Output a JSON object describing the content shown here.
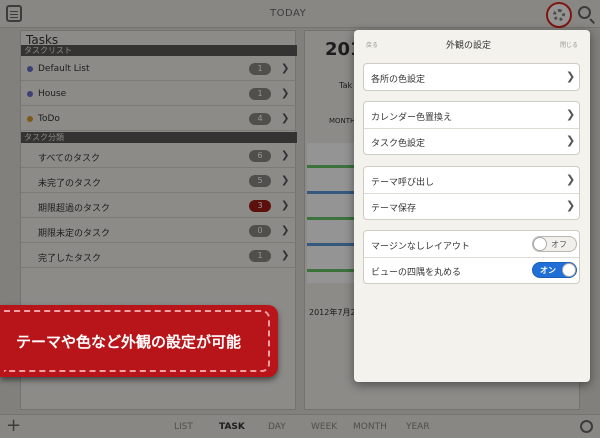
{
  "topbar": {
    "today_label": "TODAY"
  },
  "tasks": {
    "title": "Tasks",
    "list_section": "タスクリスト",
    "lists": [
      {
        "label": "Default List",
        "count": "1",
        "color": "#6a6ecf"
      },
      {
        "label": "House",
        "count": "1",
        "color": "#6a6ecf"
      },
      {
        "label": "ToDo",
        "count": "4",
        "color": "#d89a2a"
      }
    ],
    "category_section": "タスク分類",
    "categories": [
      {
        "label": "すべてのタスク",
        "count": "6"
      },
      {
        "label": "未完了のタスク",
        "count": "5"
      },
      {
        "label": "期限超過のタスク",
        "count": "3"
      },
      {
        "label": "期限未定のタスク",
        "count": "0"
      },
      {
        "label": "完了したタスク",
        "count": "1"
      }
    ]
  },
  "calendar_bg": {
    "year": "201",
    "tak": "Tak",
    "month_tab": "MONTH",
    "jul": "2012年7月2"
  },
  "bottom": {
    "tabs": [
      "LIST",
      "TASK",
      "DAY",
      "WEEK",
      "MONTH",
      "YEAR"
    ],
    "active": "TASK"
  },
  "popover": {
    "back_label": "戻る",
    "title": "外観の設定",
    "close_label": "閉じる",
    "items": {
      "part_colors": "各所の色設定",
      "calendar_color_swap": "カレンダー色置換え",
      "task_color": "タスク色設定",
      "theme_load": "テーマ呼び出し",
      "theme_save": "テーマ保存",
      "no_margin_layout": "マージンなしレイアウト",
      "rounded_corners": "ビューの四隅を丸める"
    },
    "toggles": {
      "no_margin_state": "オフ",
      "rounded_state": "オン"
    }
  },
  "banner": {
    "text": "テーマや色など外観の設定が可能"
  },
  "colors": {
    "accent_red": "#b8151b",
    "toggle_on": "#1f6fd6"
  }
}
